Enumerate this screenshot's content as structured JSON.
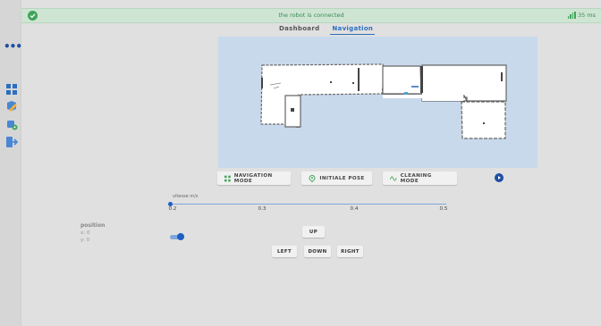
{
  "status": {
    "message": "the robot is connected",
    "latency": "35 ms",
    "color": "#3fa45a",
    "background": "#cfe5d4"
  },
  "tabs": [
    {
      "label": "Dashboard",
      "active": false
    },
    {
      "label": "Navigation",
      "active": true
    }
  ],
  "sidebar": {
    "items": [
      {
        "icon": "more-dots-icon"
      },
      {
        "icon": "dashboard-grid-icon"
      },
      {
        "icon": "map-edit-icon"
      },
      {
        "icon": "robot-settings-icon"
      },
      {
        "icon": "logout-icon"
      }
    ]
  },
  "actions": {
    "navigation_mode": "NAVIGATION MODE",
    "initial_pose": "INITIALE POSE",
    "cleaning_mode": "CLEANING MODE"
  },
  "speed": {
    "label": "vitesse m/s",
    "ticks": [
      "0.2",
      "0.3",
      "0.4",
      "0.5"
    ],
    "value": 0.2,
    "min": 0.2,
    "max": 0.5
  },
  "position": {
    "title": "position",
    "x": "x: 0",
    "y": "y: 0"
  },
  "controls": {
    "up": "UP",
    "left": "LEFT",
    "down": "DOWN",
    "right": "RIGHT"
  },
  "colors": {
    "accent": "#1f5ec2",
    "map_background": "#c9d9ec"
  }
}
